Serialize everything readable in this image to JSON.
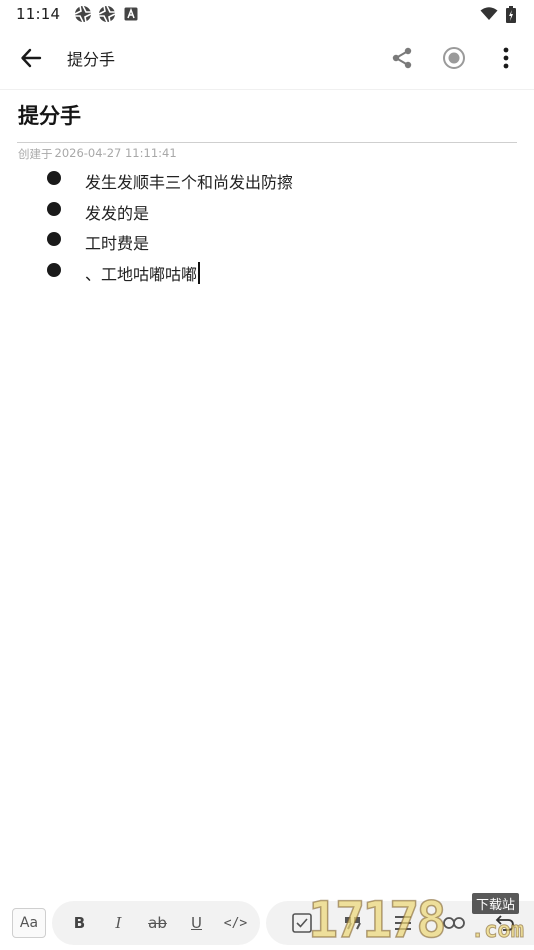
{
  "status_bar": {
    "time": "11:14",
    "left_icons": [
      "aperture-icon",
      "aperture-icon",
      "font-a-icon"
    ],
    "right_icons": [
      "wifi-icon",
      "battery-charging-icon"
    ]
  },
  "app_bar": {
    "title": "提分手",
    "back_icon": "arrow-back-icon",
    "actions": [
      "share-icon",
      "record-icon",
      "more-vert-icon"
    ]
  },
  "note": {
    "title": "提分手",
    "created_label": "创建于",
    "created_at": "2026-04-27 11:11:41",
    "bullets": [
      "发生发顺丰三个和尚发出防擦",
      "发发的是",
      "工时费是",
      "、工地咕嘟咕嘟"
    ]
  },
  "toolbar": {
    "text_style_label": "Aa",
    "bold_label": "B",
    "italic_label": "I",
    "strike_label": "ab",
    "underline_label": "U",
    "code_label": "</>",
    "icons": [
      "checkbox-icon",
      "quote-icon",
      "list-icon",
      "link-icon",
      "undo-icon"
    ]
  },
  "watermark": {
    "digits": "17178",
    "suffix": ".com",
    "tag": "下载站"
  },
  "colors": {
    "text": "#1f1f1f",
    "muted": "#a8a8a8",
    "icon": "#7a7a7a",
    "toolbar_bg": "#f2f2f2"
  }
}
